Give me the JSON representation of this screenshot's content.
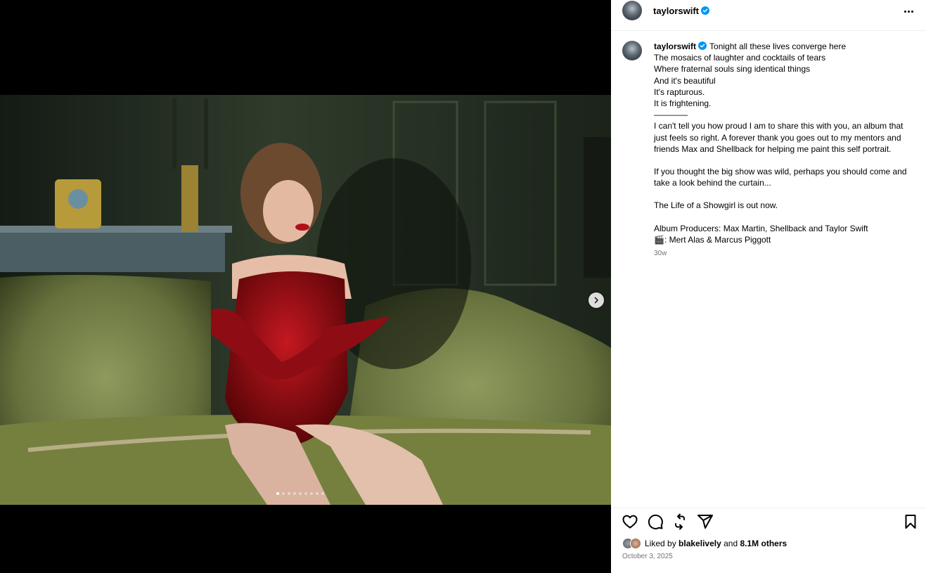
{
  "post": {
    "username": "taylorswift",
    "caption_lines": [
      "Tonight all these lives converge here",
      "The mosaics of laughter and cocktails of tears",
      "Where fraternal souls sing identical things",
      "And it's beautiful",
      "It's rapturous.",
      "It is frightening.",
      "————",
      "I can't tell you how proud I am to share this with you, an album that just feels so right. A forever thank you goes out to my mentors and friends Max and Shellback for helping me paint this self portrait.",
      "",
      "If you thought the big show was wild, perhaps you should come and take a look behind the curtain...",
      "",
      "The Life of a Showgirl is out now.",
      "",
      "Album Producers: Max Martin, Shellback and Taylor Swift",
      "🎬: Mert Alas & Marcus Piggott"
    ],
    "age": "30w",
    "liked_by_prefix": "Liked by",
    "liked_by_user": "blakelively",
    "liked_by_and": "and",
    "likes_others": "8.1M others",
    "date": "October 3, 2025"
  },
  "carousel": {
    "total_slides": 9,
    "current_slide": 1
  },
  "icons": {
    "more": "more-horizontal-icon",
    "verified": "verified-badge-icon",
    "next": "chevron-right-icon",
    "like": "heart-icon",
    "comment": "comment-icon",
    "repost": "repost-icon",
    "share": "send-icon",
    "save": "bookmark-icon"
  },
  "colors": {
    "verified": "#0095f6",
    "muted_text": "#737373",
    "divider": "#efefef"
  }
}
